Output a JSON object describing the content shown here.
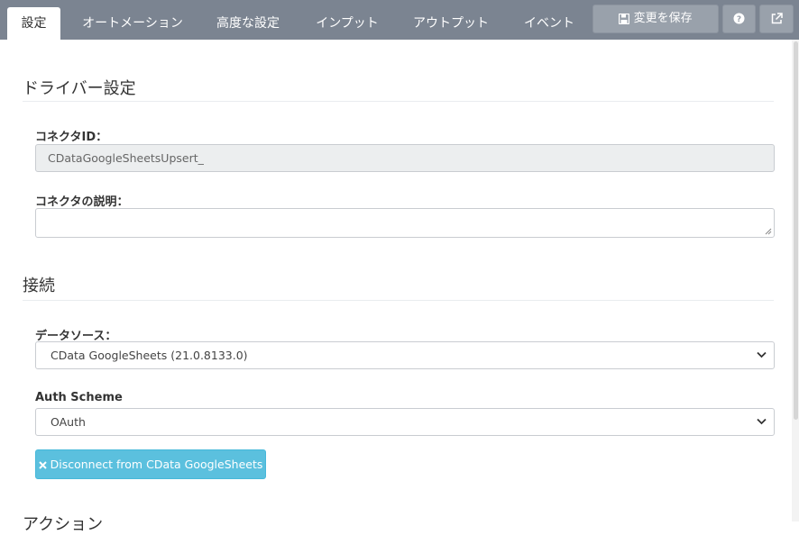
{
  "tabs": [
    {
      "label": "設定",
      "active": true
    },
    {
      "label": "オートメーション",
      "active": false
    },
    {
      "label": "高度な設定",
      "active": false
    },
    {
      "label": "インプット",
      "active": false
    },
    {
      "label": "アウトプット",
      "active": false
    },
    {
      "label": "イベント",
      "active": false
    }
  ],
  "toolbar": {
    "save_label": "変更を保存",
    "save_icon": "floppy-disk-icon",
    "help_icon": "question-circle-icon",
    "external_icon": "external-link-icon"
  },
  "driver_section": {
    "title": "ドライバー設定",
    "connector_id_label": "コネクタID：",
    "connector_id_value": "CDataGoogleSheetsUpsert_",
    "description_label": "コネクタの説明：",
    "description_value": ""
  },
  "connection_section": {
    "title": "接続",
    "datasource_label": "データソース：",
    "datasource_value": "CData GoogleSheets (21.0.8133.0)",
    "auth_label": "Auth Scheme",
    "auth_value": "OAuth",
    "disconnect_label": "Disconnect from CData GoogleSheets",
    "disconnect_icon": "close-icon"
  },
  "next_section": {
    "title": "アクション"
  },
  "colors": {
    "topbar": "#7b8491",
    "info_button": "#5bc0de"
  }
}
